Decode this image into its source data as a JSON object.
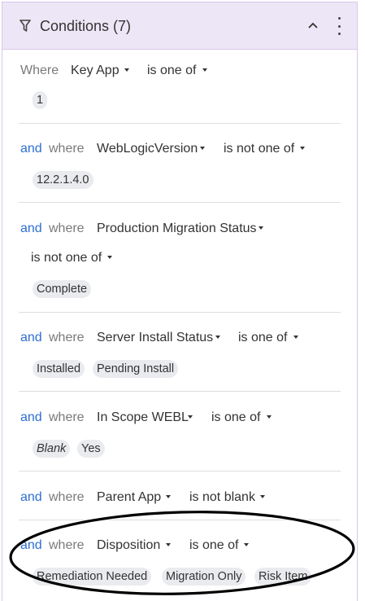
{
  "header": {
    "title": "Conditions (7)"
  },
  "conditions": [
    {
      "conjunction": "",
      "where": "Where",
      "field": "Key App",
      "operator": "is one of",
      "values": [
        "1"
      ]
    },
    {
      "conjunction": "and",
      "where": "where",
      "field": "WebLogicVersion",
      "operator": "is not one of",
      "values": [
        "12.2.1.4.0"
      ]
    },
    {
      "conjunction": "and",
      "where": "where",
      "field": "Production Migration Status",
      "operator": "is not one of",
      "values": [
        "Complete"
      ]
    },
    {
      "conjunction": "and",
      "where": "where",
      "field": "Server Install Status",
      "operator": "is one of",
      "values": [
        "Installed",
        "Pending Install"
      ]
    },
    {
      "conjunction": "and",
      "where": "where",
      "field": "In Scope WEBL",
      "operator": "is one of",
      "values": [
        "Blank",
        "Yes"
      ]
    },
    {
      "conjunction": "and",
      "where": "where",
      "field": "Parent App",
      "operator": "is not blank",
      "values": []
    },
    {
      "conjunction": "and",
      "where": "where",
      "field": "Disposition",
      "operator": "is one of",
      "values": [
        "Remediation Needed",
        "Migration Only",
        "Risk Item"
      ]
    }
  ],
  "colors": {
    "header_bg": "#ede6f6",
    "border": "#d7c8e8",
    "and_keyword": "#2e6fd0",
    "chip_bg": "#e9ebee",
    "annotation": "#000000"
  },
  "icons": {
    "header": "filter-icon",
    "collapse": "chevron-up-icon",
    "menu": "more-vertical-icon",
    "dropdown": "caret-down-icon"
  }
}
